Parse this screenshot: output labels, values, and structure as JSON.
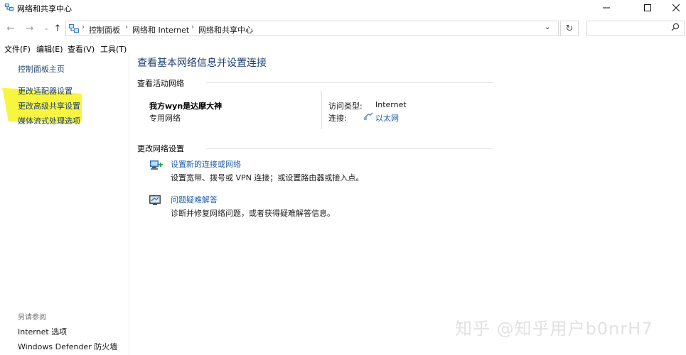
{
  "window": {
    "title": "网络和共享中心",
    "minimize_icon": "minimize-icon",
    "maximize_icon": "maximize-icon",
    "close_icon": "close-icon"
  },
  "address_bar": {
    "back_icon": "arrow-left-icon",
    "forward_icon": "arrow-right-icon",
    "recent_icon": "chevron-down-icon",
    "up_icon": "arrow-up-icon",
    "crumbs": [
      "控制面板",
      "网络和 Internet",
      "网络和共享中心"
    ],
    "search_placeholder": ""
  },
  "menu": [
    "文件(F)",
    "编辑(E)",
    "查看(V)",
    "工具(T)"
  ],
  "left_nav": {
    "home": "控制面板主页",
    "links": [
      "更改适配器设置",
      "更改高级共享设置",
      "媒体流式处理选项"
    ],
    "see_also_label": "另请参阅",
    "see_also": [
      "Internet 选项",
      "Windows Defender 防火墙"
    ]
  },
  "main": {
    "title": "查看基本网络信息并设置连接",
    "active_section": "查看活动网络",
    "network": {
      "name": "我方wyn是达摩大神",
      "type": "专用网络",
      "access_label": "访问类型:",
      "access_value": "Internet",
      "conn_label": "连接:",
      "conn_value": "以太网"
    },
    "change_section": "更改网络设置",
    "actions": [
      {
        "title": "设置新的连接或网络",
        "desc": "设置宽带、拨号或 VPN 连接；或设置路由器或接入点。"
      },
      {
        "title": "问题疑难解答",
        "desc": "诊断并修复网络问题，或者获得疑难解答信息。"
      }
    ]
  },
  "watermark": "知乎 @知乎用户b0nrH7",
  "colors": {
    "link": "#1f5ea8",
    "nav_link": "#1f3f6e",
    "title": "#1e3f73",
    "highlight": "#f7f31e"
  }
}
